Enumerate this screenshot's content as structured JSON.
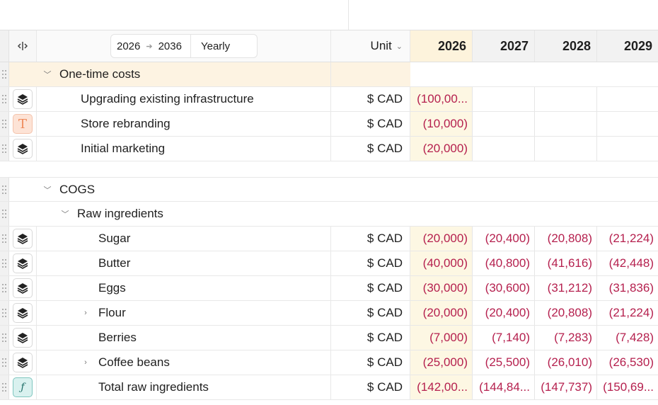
{
  "header": {
    "range_start": "2026",
    "range_end": "2036",
    "period": "Yearly",
    "unit_label": "Unit",
    "years": [
      "2026",
      "2027",
      "2028",
      "2029"
    ]
  },
  "groups": [
    {
      "label": "One-time costs",
      "rows": [
        {
          "name": "Upgrading existing infrastructure",
          "unit": "$ CAD",
          "values": [
            "(100,00...",
            "",
            "",
            ""
          ]
        },
        {
          "name": "Store rebranding",
          "unit": "$ CAD",
          "values": [
            "(10,000)",
            "",
            "",
            ""
          ]
        },
        {
          "name": "Initial marketing",
          "unit": "$ CAD",
          "values": [
            "(20,000)",
            "",
            "",
            ""
          ]
        }
      ]
    },
    {
      "label": "COGS",
      "subgroup": "Raw ingredients",
      "rows": [
        {
          "name": "Sugar",
          "unit": "$ CAD",
          "values": [
            "(20,000)",
            "(20,400)",
            "(20,808)",
            "(21,224)"
          ]
        },
        {
          "name": "Butter",
          "unit": "$ CAD",
          "values": [
            "(40,000)",
            "(40,800)",
            "(41,616)",
            "(42,448)"
          ]
        },
        {
          "name": "Eggs",
          "unit": "$ CAD",
          "values": [
            "(30,000)",
            "(30,600)",
            "(31,212)",
            "(31,836)"
          ]
        },
        {
          "name": "Flour",
          "unit": "$ CAD",
          "values": [
            "(20,000)",
            "(20,400)",
            "(20,808)",
            "(21,224)"
          ]
        },
        {
          "name": "Berries",
          "unit": "$ CAD",
          "values": [
            "(7,000)",
            "(7,140)",
            "(7,283)",
            "(7,428)"
          ]
        },
        {
          "name": "Coffee beans",
          "unit": "$ CAD",
          "values": [
            "(25,000)",
            "(25,500)",
            "(26,010)",
            "(26,530)"
          ]
        },
        {
          "name": "Total raw ingredients",
          "unit": "$ CAD",
          "values": [
            "(142,00...",
            "(144,84...",
            "(147,737)",
            "(150,69..."
          ]
        }
      ]
    }
  ],
  "icons": {
    "column-toggle": "split-columns-icon",
    "stack": "layers-icon",
    "text": "text-type-icon",
    "formula": "formula-icon"
  },
  "colors": {
    "negative_value": "#b5204e",
    "current_year_bg": "#fdf7e3",
    "group_band_bg": "#fdf3e2",
    "formula_icon_bg": "#d9f1ef",
    "text_icon_bg": "#fde3d6"
  }
}
